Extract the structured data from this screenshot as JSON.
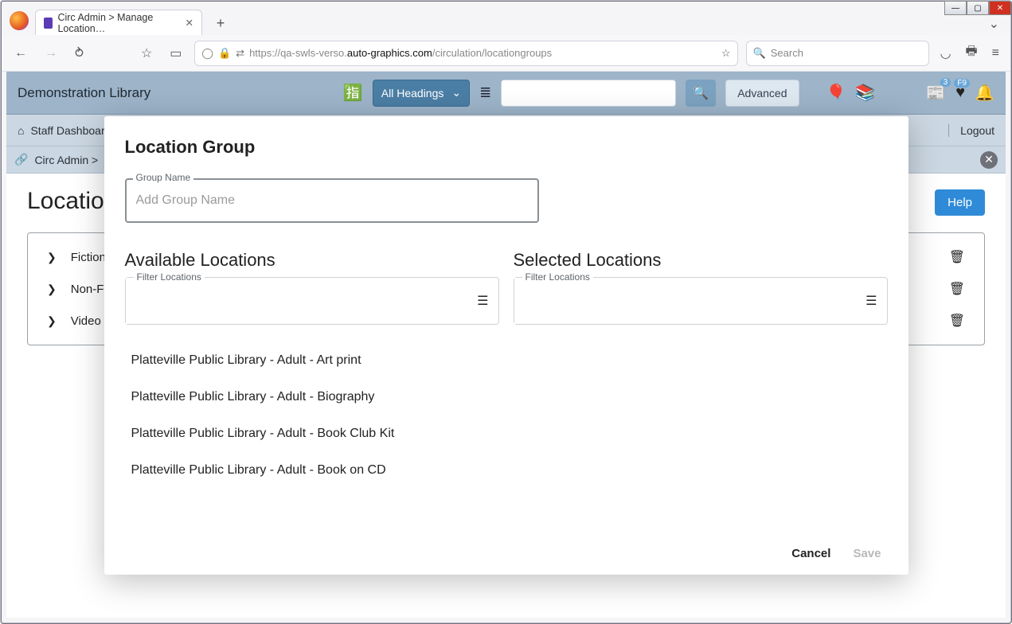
{
  "browser": {
    "tab_title": "Circ Admin > Manage Location…",
    "url_prefix": "https://qa-swls-verso.",
    "url_domain": "auto-graphics.com",
    "url_path": "/circulation/locationgroups",
    "search_placeholder": "Search"
  },
  "app_header": {
    "library_name": "Demonstration Library",
    "heading_select": "All Headings",
    "advanced_label": "Advanced",
    "badge_count": "3",
    "badge_f9": "F9"
  },
  "nav": {
    "staff_dashboard": "Staff Dashboard",
    "logout": "Logout",
    "breadcrumb": "Circ Admin  >"
  },
  "page": {
    "title": "Location",
    "help_label": "Help",
    "groups": [
      {
        "label": "Fiction"
      },
      {
        "label": "Non-Fiction"
      },
      {
        "label": "Video"
      }
    ]
  },
  "modal": {
    "title": "Location Group",
    "group_name_label": "Group Name",
    "group_name_placeholder": "Add Group Name",
    "available_label": "Available Locations",
    "selected_label": "Selected Locations",
    "filter_label": "Filter Locations",
    "cancel": "Cancel",
    "save": "Save",
    "available_items": [
      "Platteville Public Library - Adult - Art print",
      "Platteville Public Library - Adult - Biography",
      "Platteville Public Library - Adult - Book Club Kit",
      "Platteville Public Library - Adult - Book on CD"
    ]
  }
}
